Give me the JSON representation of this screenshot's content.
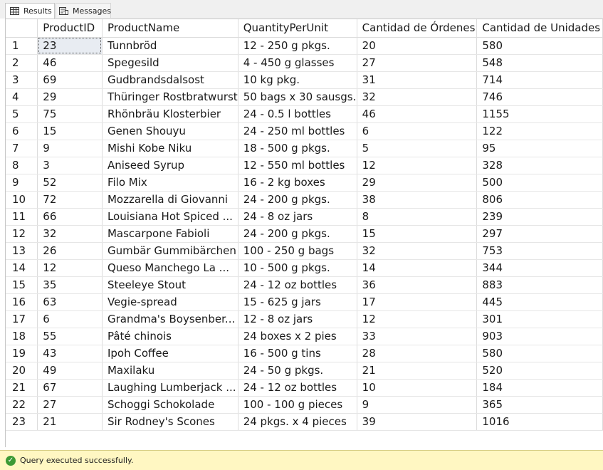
{
  "tabs": [
    {
      "label": "Results",
      "icon": "grid-icon",
      "active": true
    },
    {
      "label": "Messages",
      "icon": "messages-icon",
      "active": false
    }
  ],
  "grid": {
    "columns": [
      "",
      "ProductID",
      "ProductName",
      "QuantityPerUnit",
      "Cantidad de Órdenes",
      "Cantidad de Unidades"
    ],
    "rows": [
      [
        "1",
        "23",
        "Tunnbröd",
        "12 - 250 g pkgs.",
        "20",
        "580"
      ],
      [
        "2",
        "46",
        "Spegesild",
        "4 - 450 g glasses",
        "27",
        "548"
      ],
      [
        "3",
        "69",
        "Gudbrandsdalsost",
        "10 kg pkg.",
        "31",
        "714"
      ],
      [
        "4",
        "29",
        "Thüringer Rostbratwurst",
        "50 bags x 30 sausgs.",
        "32",
        "746"
      ],
      [
        "5",
        "75",
        "Rhönbräu Klosterbier",
        "24 - 0.5 l bottles",
        "46",
        "1155"
      ],
      [
        "6",
        "15",
        "Genen Shouyu",
        "24 - 250 ml bottles",
        "6",
        "122"
      ],
      [
        "7",
        "9",
        "Mishi Kobe Niku",
        "18 - 500 g pkgs.",
        "5",
        "95"
      ],
      [
        "8",
        "3",
        "Aniseed Syrup",
        "12 - 550 ml bottles",
        "12",
        "328"
      ],
      [
        "9",
        "52",
        "Filo Mix",
        "16 - 2 kg boxes",
        "29",
        "500"
      ],
      [
        "10",
        "72",
        "Mozzarella di Giovanni",
        "24 - 200 g pkgs.",
        "38",
        "806"
      ],
      [
        "11",
        "66",
        "Louisiana Hot Spiced ...",
        "24 - 8 oz jars",
        "8",
        "239"
      ],
      [
        "12",
        "32",
        "Mascarpone Fabioli",
        "24 - 200 g pkgs.",
        "15",
        "297"
      ],
      [
        "13",
        "26",
        "Gumbär Gummibärchen",
        "100 - 250 g bags",
        "32",
        "753"
      ],
      [
        "14",
        "12",
        "Queso Manchego La ...",
        "10 - 500 g pkgs.",
        "14",
        "344"
      ],
      [
        "15",
        "35",
        "Steeleye Stout",
        "24 - 12 oz bottles",
        "36",
        "883"
      ],
      [
        "16",
        "63",
        "Vegie-spread",
        "15 - 625 g jars",
        "17",
        "445"
      ],
      [
        "17",
        "6",
        "Grandma's Boysenber...",
        "12 - 8 oz jars",
        "12",
        "301"
      ],
      [
        "18",
        "55",
        "Pâté chinois",
        "24 boxes x 2 pies",
        "33",
        "903"
      ],
      [
        "19",
        "43",
        "Ipoh Coffee",
        "16 - 500 g tins",
        "28",
        "580"
      ],
      [
        "20",
        "49",
        "Maxilaku",
        "24 - 50 g pkgs.",
        "21",
        "520"
      ],
      [
        "21",
        "67",
        "Laughing Lumberjack ...",
        "24 - 12 oz bottles",
        "10",
        "184"
      ],
      [
        "22",
        "27",
        "Schoggi Schokolade",
        "100 - 100 g pieces",
        "9",
        "365"
      ],
      [
        "23",
        "21",
        "Sir Rodney's Scones",
        "24 pkgs. x 4 pieces",
        "39",
        "1016"
      ]
    ]
  },
  "status": {
    "icon": "check-circle-icon",
    "text": "Query executed successfully.",
    "background": "#fff7c2",
    "icon_color": "#3c9a35"
  }
}
